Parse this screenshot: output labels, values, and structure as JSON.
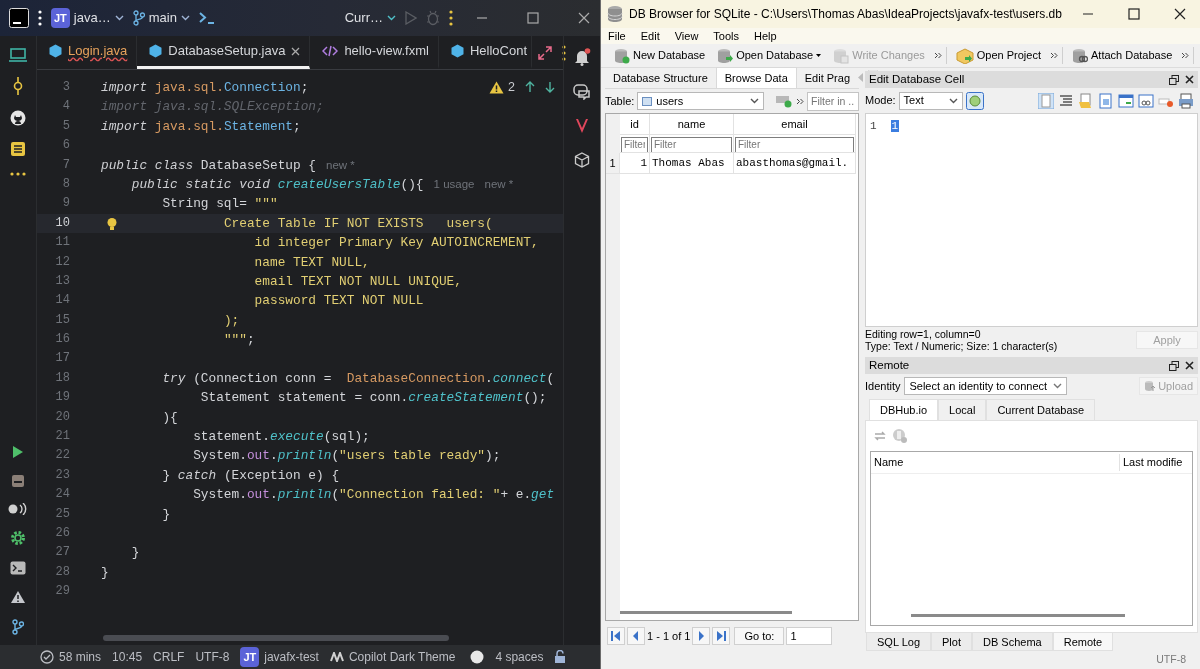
{
  "ide": {
    "project": {
      "initials": "JT",
      "name": "java…"
    },
    "branch": "main",
    "run_config": "Curr…",
    "tabs": [
      {
        "label": "Login.java",
        "kind": "java",
        "selected": false,
        "error": true
      },
      {
        "label": "DatabaseSetup.java",
        "kind": "java",
        "selected": true,
        "error": false
      },
      {
        "label": "hello-view.fxml",
        "kind": "fxml",
        "selected": false,
        "error": false
      },
      {
        "label": "HelloCont",
        "kind": "java",
        "selected": false,
        "error": false
      }
    ],
    "warnings": "2",
    "code_lines": [
      {
        "number": "3",
        "current": false,
        "tokens": [
          {
            "kind": "kw",
            "text": "import"
          },
          {
            "kind": "pkg",
            "text": " java.sql."
          },
          {
            "kind": "type",
            "text": "Connection"
          },
          {
            "kind": "plain",
            "text": ";"
          }
        ]
      },
      {
        "number": "4",
        "current": false,
        "tokens": [
          {
            "kind": "dim",
            "text": "import java.sql.SQLException;"
          }
        ]
      },
      {
        "number": "5",
        "current": false,
        "tokens": [
          {
            "kind": "kw",
            "text": "import"
          },
          {
            "kind": "pkg",
            "text": " java.sql."
          },
          {
            "kind": "type",
            "text": "Statement"
          },
          {
            "kind": "plain",
            "text": ";"
          }
        ]
      },
      {
        "number": "6",
        "current": false
      },
      {
        "number": "7",
        "current": false,
        "tokens": [
          {
            "kind": "kw",
            "text": "public class"
          },
          {
            "kind": "plain",
            "text": " DatabaseSetup {"
          }
        ],
        "hints": [
          "new *"
        ]
      },
      {
        "number": "8",
        "current": false,
        "tokens": [
          {
            "kind": "kw",
            "text": "    public static void"
          },
          {
            "kind": "method",
            "text": " createUsersTable"
          },
          {
            "kind": "plain",
            "text": "(){"
          }
        ],
        "hints": [
          "1 usage",
          "new *"
        ]
      },
      {
        "number": "9",
        "current": false,
        "tokens": [
          {
            "kind": "plain",
            "text": "        String sql= "
          },
          {
            "kind": "str",
            "text": "\"\"\""
          }
        ]
      },
      {
        "number": "10",
        "current": true,
        "tokens": [
          {
            "kind": "str",
            "text": "                Create Table IF NOT EXISTS   users("
          }
        ]
      },
      {
        "number": "11",
        "current": false,
        "tokens": [
          {
            "kind": "str",
            "text": "                    id integer Primary Key AUTOINCREMENT,"
          }
        ]
      },
      {
        "number": "12",
        "current": false,
        "tokens": [
          {
            "kind": "str",
            "text": "                    name TEXT NULL,"
          }
        ]
      },
      {
        "number": "13",
        "current": false,
        "tokens": [
          {
            "kind": "str",
            "text": "                    email TEXT NOT NULL UNIQUE,"
          }
        ]
      },
      {
        "number": "14",
        "current": false,
        "tokens": [
          {
            "kind": "str",
            "text": "                    password TEXT NOT NULL"
          }
        ]
      },
      {
        "number": "15",
        "current": false,
        "tokens": [
          {
            "kind": "str",
            "text": "                );"
          }
        ]
      },
      {
        "number": "16",
        "current": false,
        "tokens": [
          {
            "kind": "str",
            "text": "                \"\"\""
          },
          {
            "kind": "plain",
            "text": ";"
          }
        ]
      },
      {
        "number": "17",
        "current": false
      },
      {
        "number": "18",
        "current": false,
        "tokens": [
          {
            "kind": "kw",
            "text": "        try"
          },
          {
            "kind": "plain",
            "text": " (Connection conn =  "
          },
          {
            "kind": "cls",
            "text": "DatabaseConnection"
          },
          {
            "kind": "plain",
            "text": "."
          },
          {
            "kind": "method",
            "text": "connect"
          },
          {
            "kind": "plain",
            "text": "("
          }
        ]
      },
      {
        "number": "19",
        "current": false,
        "tokens": [
          {
            "kind": "plain",
            "text": "             Statement statement = conn."
          },
          {
            "kind": "method",
            "text": "createStatement"
          },
          {
            "kind": "plain",
            "text": "();"
          }
        ]
      },
      {
        "number": "20",
        "current": false,
        "tokens": [
          {
            "kind": "plain",
            "text": "        ){"
          }
        ]
      },
      {
        "number": "21",
        "current": false,
        "tokens": [
          {
            "kind": "plain",
            "text": "            statement."
          },
          {
            "kind": "method",
            "text": "execute"
          },
          {
            "kind": "plain",
            "text": "(sql);"
          }
        ]
      },
      {
        "number": "22",
        "current": false,
        "tokens": [
          {
            "kind": "plain",
            "text": "            System."
          },
          {
            "kind": "field",
            "text": "out"
          },
          {
            "kind": "plain",
            "text": "."
          },
          {
            "kind": "method",
            "text": "println"
          },
          {
            "kind": "plain",
            "text": "("
          },
          {
            "kind": "str",
            "text": "\"users table ready\""
          },
          {
            "kind": "plain",
            "text": ");"
          }
        ]
      },
      {
        "number": "23",
        "current": false,
        "tokens": [
          {
            "kind": "plain",
            "text": "        } "
          },
          {
            "kind": "kw",
            "text": "catch"
          },
          {
            "kind": "plain",
            "text": " (Exception e) {"
          }
        ]
      },
      {
        "number": "24",
        "current": false,
        "tokens": [
          {
            "kind": "plain",
            "text": "            System."
          },
          {
            "kind": "field",
            "text": "out"
          },
          {
            "kind": "plain",
            "text": "."
          },
          {
            "kind": "method",
            "text": "println"
          },
          {
            "kind": "plain",
            "text": "("
          },
          {
            "kind": "str",
            "text": "\"Connection failed: \""
          },
          {
            "kind": "plain",
            "text": "+ e."
          },
          {
            "kind": "method",
            "text": "get"
          }
        ]
      },
      {
        "number": "25",
        "current": false,
        "tokens": [
          {
            "kind": "plain",
            "text": "        }"
          }
        ]
      },
      {
        "number": "26",
        "current": false
      },
      {
        "number": "27",
        "current": false,
        "tokens": [
          {
            "kind": "plain",
            "text": "    }"
          }
        ]
      },
      {
        "number": "28",
        "current": false,
        "tokens": [
          {
            "kind": "plain",
            "text": "}"
          }
        ]
      },
      {
        "number": "29",
        "current": false
      }
    ],
    "status_bar": {
      "time_spent": "58 mins",
      "position": "10:45",
      "line_ending": "CRLF",
      "encoding": "UTF-8",
      "project_initials": "JT",
      "project": "javafx-test",
      "theme": "Copilot Dark Theme",
      "indent": "4 spaces"
    }
  },
  "db_browser": {
    "title": "DB Browser for SQLite - C:\\Users\\Thomas Abas\\IdeaProjects\\javafx-test\\users.db",
    "menu": [
      "File",
      "Edit",
      "View",
      "Tools",
      "Help"
    ],
    "toolbar_groups": [
      {
        "items": [
          {
            "label": "New Database",
            "kind": "new",
            "disabled": false
          },
          {
            "label": "Open Database",
            "kind": "open",
            "disabled": false
          },
          {
            "label": "Write Changes",
            "kind": "write",
            "disabled": true
          }
        ]
      },
      {
        "items": [
          {
            "label": "Open Project",
            "kind": "project",
            "disabled": false
          }
        ]
      },
      {
        "items": [
          {
            "label": "Attach Database",
            "kind": "attach",
            "disabled": false
          }
        ]
      }
    ],
    "main_tabs": [
      {
        "label": "Database Structure",
        "selected": false
      },
      {
        "label": "Browse Data",
        "selected": true
      },
      {
        "label": "Edit Prag",
        "selected": false
      }
    ],
    "table_label": "Table:",
    "table": "users",
    "filter": {
      "placeholder": "Filter in ..."
    },
    "grid": {
      "columns": [
        "id",
        "name",
        "email"
      ],
      "filters": [
        {
          "placeholder": "Filter"
        },
        {
          "placeholder": "Filter"
        },
        {
          "placeholder": "Filter"
        }
      ],
      "rows": [
        {
          "number": "1",
          "cells": [
            "1",
            "Thomas Abas",
            "abasthomas@gmail."
          ]
        }
      ]
    },
    "navigation": {
      "range": "1 - 1 of 1",
      "goto_label": "Go to:",
      "goto_value": "1"
    },
    "edit_cell": {
      "title": "Edit Database Cell",
      "mode_label": "Mode:",
      "mode": "Text",
      "line_number": "1",
      "value": "1",
      "status": [
        "Editing row=1, column=0",
        "Type: Text / Numeric; Size: 1 character(s)"
      ],
      "apply": {
        "label": "Apply",
        "disabled": true
      }
    },
    "remote": {
      "title": "Remote",
      "identity_label": "Identity",
      "identity": "Select an identity to connect",
      "upload": {
        "label": "Upload",
        "disabled": true
      },
      "tabs": [
        {
          "label": "DBHub.io",
          "selected": true
        },
        {
          "label": "Local",
          "selected": false
        },
        {
          "label": "Current Database",
          "selected": false
        }
      ],
      "columns": [
        "Name",
        "Last modifie"
      ]
    },
    "bottom_tabs": [
      {
        "label": "SQL Log",
        "selected": false
      },
      {
        "label": "Plot",
        "selected": false
      },
      {
        "label": "DB Schema",
        "selected": false
      },
      {
        "label": "Remote",
        "selected": true
      }
    ],
    "status_bar": "UTF-8"
  }
}
